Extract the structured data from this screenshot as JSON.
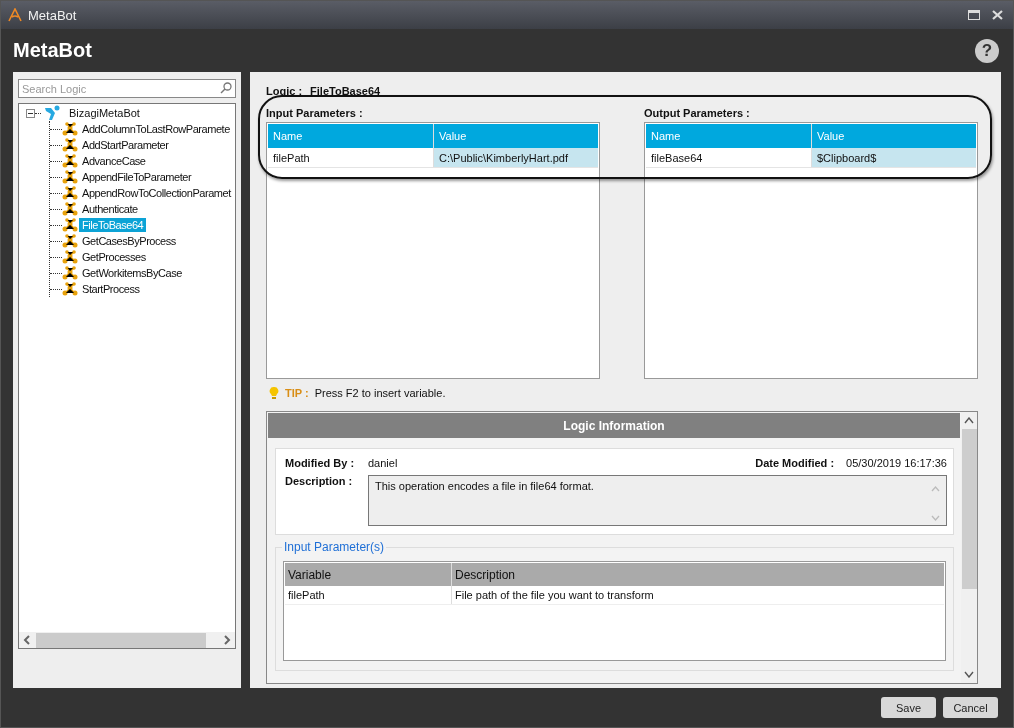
{
  "window": {
    "title": "MetaBot"
  },
  "header": {
    "title": "MetaBot",
    "help": "?"
  },
  "search": {
    "placeholder": "Search Logic"
  },
  "tree": {
    "label": "BizagiMetaBot",
    "expanded": true,
    "children": [
      {
        "label": "AddColumnToLastRowParamete",
        "selected": false
      },
      {
        "label": "AddStartParameter",
        "selected": false
      },
      {
        "label": "AdvanceCase",
        "selected": false
      },
      {
        "label": "AppendFileToParameter",
        "selected": false
      },
      {
        "label": "AppendRowToCollectionParamet",
        "selected": false
      },
      {
        "label": "Authenticate",
        "selected": false
      },
      {
        "label": "FileToBase64",
        "selected": true
      },
      {
        "label": "GetCasesByProcess",
        "selected": false
      },
      {
        "label": "GetProcesses",
        "selected": false
      },
      {
        "label": "GetWorkitemsByCase",
        "selected": false
      },
      {
        "label": "StartProcess",
        "selected": false
      }
    ]
  },
  "logic": {
    "label": "Logic :",
    "value": "FileToBase64"
  },
  "parameter_tables": [
    {
      "title": "Input Parameters :",
      "columns": [
        "Name",
        "Value"
      ],
      "rows": [
        [
          "filePath",
          "C:\\Public\\KimberlyHart.pdf"
        ]
      ]
    },
    {
      "title": "Output Parameters :",
      "columns": [
        "Name",
        "Value"
      ],
      "rows": [
        [
          "fileBase64",
          "$Clipboard$"
        ]
      ]
    }
  ],
  "tip": {
    "label": "TIP :",
    "text": "Press F2 to insert variable."
  },
  "logic_information": {
    "title": "Logic Information",
    "modified_by_label": "Modified By :",
    "modified_by": "daniel",
    "date_modified_label": "Date Modified :",
    "date_modified": "05/30/2019 16:17:36",
    "description_label": "Description :",
    "description": "This operation encodes a file in file64 format.",
    "input_parameters": {
      "title": "Input Parameter(s)",
      "columns": [
        "Variable",
        "Description"
      ],
      "rows": [
        [
          "filePath",
          "File path of the file you want to transform"
        ]
      ]
    }
  },
  "buttons": [
    "Save",
    "Cancel"
  ]
}
